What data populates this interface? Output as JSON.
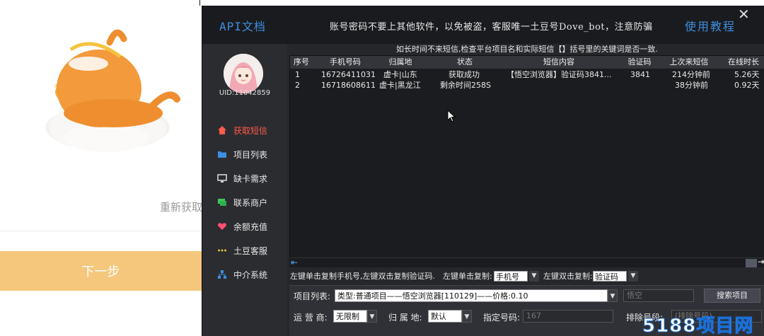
{
  "background_app": {
    "refetch_text": "重新获取",
    "next_button": "下一步"
  },
  "window": {
    "api_doc": "API文档",
    "notice": "账号密码不要上其他软件，以免被盗，客服唯一土豆号Dove_bot，注意防骗",
    "tutorial": "使用教程",
    "close": "✕"
  },
  "sidebar": {
    "uid": "UID:11042859",
    "items": [
      {
        "label": "获取短信",
        "icon": "home-icon",
        "active": true
      },
      {
        "label": "项目列表",
        "icon": "folder-icon",
        "active": false
      },
      {
        "label": "缺卡需求",
        "icon": "monitor-icon",
        "active": false
      },
      {
        "label": "联系商户",
        "icon": "chat-icon",
        "active": false
      },
      {
        "label": "余额充值",
        "icon": "heart-icon",
        "active": false
      },
      {
        "label": "土豆客服",
        "icon": "dots-icon",
        "active": false
      },
      {
        "label": "中介系统",
        "icon": "network-icon",
        "active": false
      }
    ]
  },
  "tip": "如长时间不来短信,检查平台项目名和实际短信【】括号里的关键词是否一致.",
  "table": {
    "headers": [
      "序号",
      "手机号码",
      "归属地",
      "状态",
      "短信内容",
      "验证码",
      "上次来短信",
      "在线时长"
    ],
    "rows": [
      [
        "1",
        "16726411031",
        "虚卡|山东",
        "获取成功",
        "【悟空浏览器】验证码3841...",
        "3841",
        "214分钟前",
        "5.26天"
      ],
      [
        "2",
        "16718608611",
        "虚卡|黑龙江",
        "剩余时间258S",
        "",
        "",
        "38分钟前",
        "0.92天"
      ]
    ]
  },
  "copy_hint": {
    "text": "左键单击复制手机号,左键双击复制验证码.",
    "single_label": "左键单击复制:",
    "single_value": "手机号",
    "double_label": "左键双击复制:",
    "double_value": "验证码"
  },
  "form": {
    "project_label": "项目列表:",
    "project_value": "类型:普通项目——悟空浏览器[110129]——价格:0.10",
    "search_placeholder": "悟空",
    "search_button": "搜索项目",
    "operator_label": "运 营 商:",
    "operator_value": "无限制",
    "region_label": "归 属 地:",
    "region_value": "默认",
    "number_label": "指定号码:",
    "number_placeholder": "167",
    "exclude_label": "排除号段:",
    "exclude_placeholder": "(排除号段)"
  },
  "watermark": "5188项目网",
  "colors": {
    "accent_blue": "#3d8fe0",
    "active_red": "#ff5a4a",
    "bg_button_yellow": "#f4c77c"
  }
}
